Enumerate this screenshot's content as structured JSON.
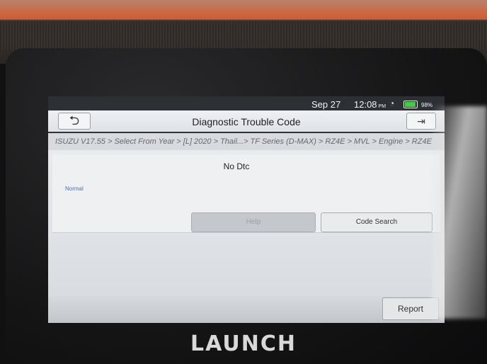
{
  "device": {
    "brand": "LAUNCH"
  },
  "status_bar": {
    "date": "Sep 27",
    "time": "12:08",
    "ampm": "PM",
    "battery_text": "98%",
    "wifi_icon": "wifi-icon",
    "battery_icon": "battery-icon"
  },
  "title_bar": {
    "title": "Diagnostic Trouble Code",
    "back_icon": "back-arrow-icon",
    "exit_icon": "exit-icon"
  },
  "breadcrumb": "ISUZU V17.55 > Select From Year > [L] 2020 > Thail...> TF Series (D-MAX) > RZ4E > MVL > Engine > RZ4E",
  "dtc": {
    "message": "No Dtc",
    "status": "Normal"
  },
  "buttons": {
    "help": "Help",
    "code_search": "Code Search",
    "report": "Report"
  },
  "colors": {
    "device_accent": "#d25d33",
    "battery": "#3cd23c",
    "status_text": "#4a6fb4"
  }
}
